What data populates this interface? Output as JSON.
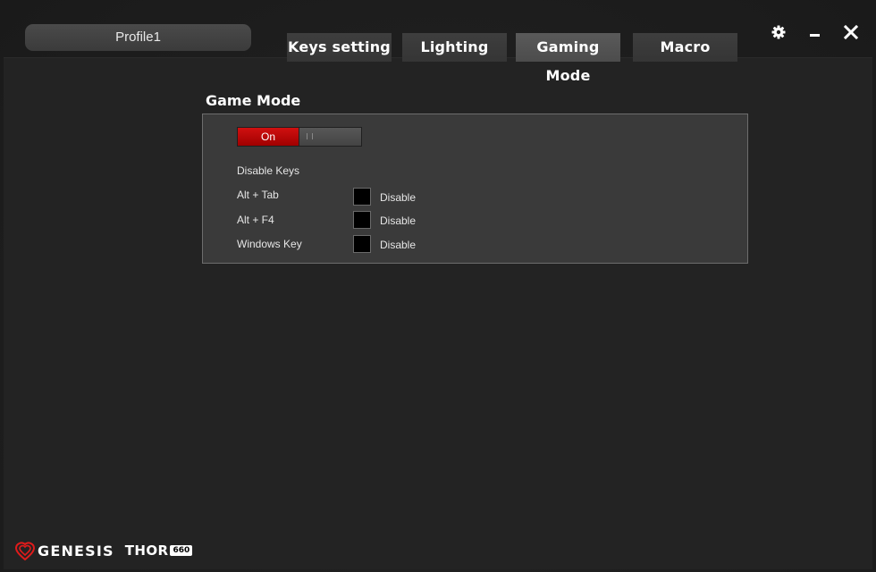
{
  "header": {
    "profile_name": "Profile1",
    "tabs": [
      {
        "label": "Keys setting",
        "active": false
      },
      {
        "label": "Lighting",
        "active": false
      },
      {
        "label": "Gaming Mode",
        "active": true
      },
      {
        "label": "Macro",
        "active": false
      }
    ],
    "window_controls": {
      "settings_icon": "gear-icon",
      "minimize_icon": "minimize-icon",
      "close_icon": "close-icon"
    }
  },
  "game_mode": {
    "title": "Game Mode",
    "toggle_label": "On",
    "toggle_state": "on",
    "disable_keys_heading": "Disable Keys",
    "keys": [
      {
        "label": "Alt + Tab",
        "checkbox_label": "Disable",
        "checked": false
      },
      {
        "label": "Alt + F4",
        "checkbox_label": "Disable",
        "checked": false
      },
      {
        "label": "Windows Key",
        "checkbox_label": "Disable",
        "checked": false
      }
    ]
  },
  "footer": {
    "brand": "GENESIS",
    "model": "THOR",
    "model_badge": "660"
  },
  "colors": {
    "background": "#1f1f1f",
    "panel": "#3a3a3a",
    "accent_red": "#d01010",
    "text": "#e6e6e6"
  }
}
